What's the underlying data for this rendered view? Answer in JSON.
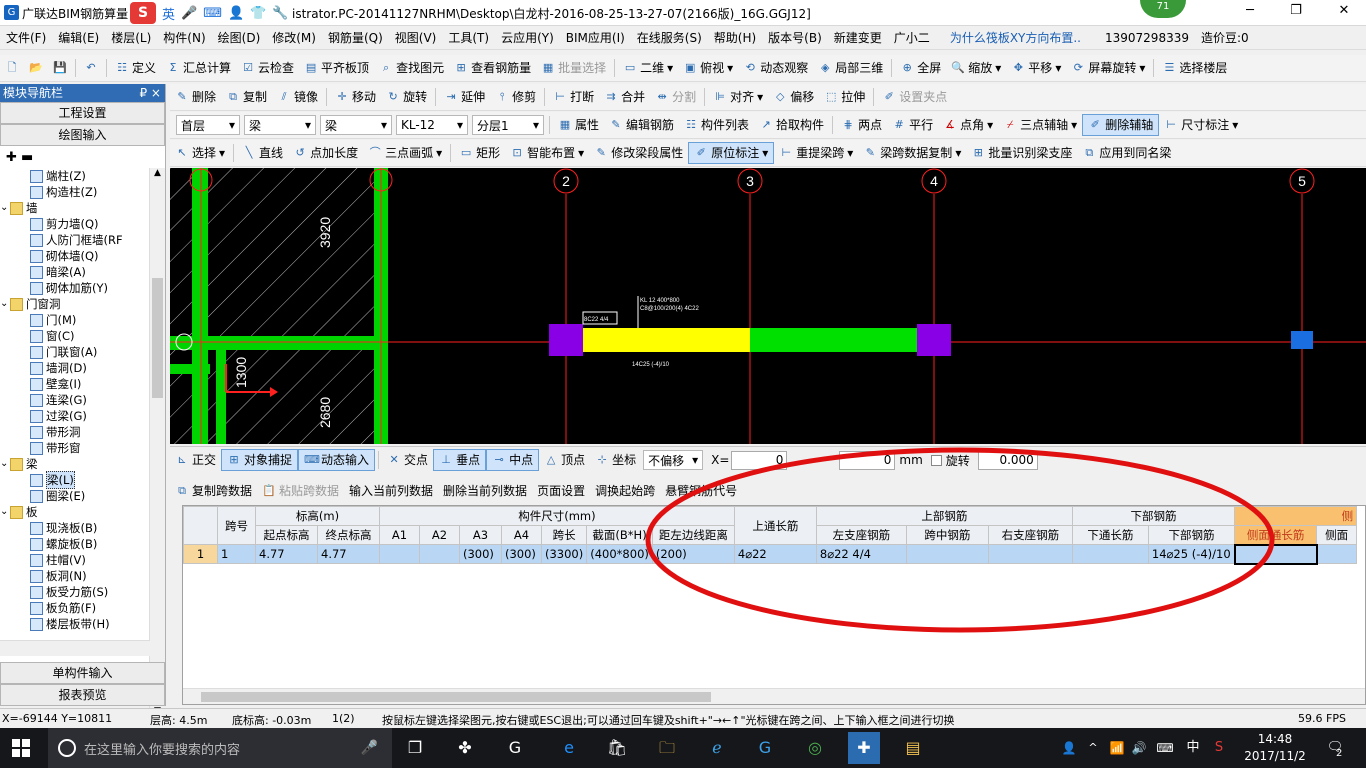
{
  "titlebar": {
    "app_title": "广联达BIM钢筋算量",
    "file_path": "istrator.PC-20141127NRHM\\Desktop\\白龙村-2016-08-25-13-27-07(2166版)_16G.GGJ12]",
    "ime_brand": "S",
    "ime_lang": "英",
    "notif_count": "71"
  },
  "menu": [
    "文件(F)",
    "编辑(E)",
    "楼层(L)",
    "构件(N)",
    "绘图(D)",
    "修改(M)",
    "钢筋量(Q)",
    "视图(V)",
    "工具(T)",
    "云应用(Y)",
    "BIM应用(I)",
    "在线服务(S)",
    "帮助(H)",
    "版本号(B)",
    "新建变更",
    "广小二",
    "为什么筏板XY方向布置..",
    "13907298339",
    "造价豆:0"
  ],
  "toolbar1": [
    "定义",
    "汇总计算",
    "云检查",
    "平齐板顶",
    "查找图元",
    "查看钢筋量",
    "批量选择",
    "二维",
    "俯视",
    "动态观察",
    "局部三维",
    "全屏",
    "缩放",
    "平移",
    "屏幕旋转",
    "选择楼层"
  ],
  "toolbar2": [
    "删除",
    "复制",
    "镜像",
    "移动",
    "旋转",
    "延伸",
    "修剪",
    "打断",
    "合并",
    "分割",
    "对齐",
    "偏移",
    "拉伸",
    "设置夹点"
  ],
  "toolbar3": {
    "floor": "首层",
    "type1": "梁",
    "type2": "梁",
    "member": "KL-12",
    "layer": "分层1",
    "items": [
      "属性",
      "编辑钢筋",
      "构件列表",
      "拾取构件",
      "两点",
      "平行",
      "点角",
      "三点辅轴",
      "删除辅轴",
      "尺寸标注"
    ]
  },
  "toolbar4": [
    "选择",
    "直线",
    "点加长度",
    "三点画弧",
    "矩形",
    "智能布置",
    "修改梁段属性",
    "原位标注",
    "重提梁跨",
    "梁跨数据复制",
    "批量识别梁支座",
    "应用到同名梁"
  ],
  "leftpanel": {
    "title": "模块导航栏",
    "pin": "₽ ×",
    "btn_project": "工程设置",
    "btn_draw": "绘图输入",
    "btn_single": "单构件输入",
    "btn_report": "报表预览",
    "tree": [
      {
        "label": "端柱(Z)",
        "indent": 3,
        "folder": false
      },
      {
        "label": "构造柱(Z)",
        "indent": 3,
        "folder": false
      },
      {
        "label": "墙",
        "indent": 1,
        "folder": true
      },
      {
        "label": "剪力墙(Q)",
        "indent": 3,
        "folder": false
      },
      {
        "label": "人防门框墙(RF",
        "indent": 3,
        "folder": false
      },
      {
        "label": "砌体墙(Q)",
        "indent": 3,
        "folder": false
      },
      {
        "label": "暗梁(A)",
        "indent": 3,
        "folder": false
      },
      {
        "label": "砌体加筋(Y)",
        "indent": 3,
        "folder": false
      },
      {
        "label": "门窗洞",
        "indent": 1,
        "folder": true
      },
      {
        "label": "门(M)",
        "indent": 3,
        "folder": false
      },
      {
        "label": "窗(C)",
        "indent": 3,
        "folder": false
      },
      {
        "label": "门联窗(A)",
        "indent": 3,
        "folder": false
      },
      {
        "label": "墙洞(D)",
        "indent": 3,
        "folder": false
      },
      {
        "label": "壁龛(I)",
        "indent": 3,
        "folder": false
      },
      {
        "label": "连梁(G)",
        "indent": 3,
        "folder": false
      },
      {
        "label": "过梁(G)",
        "indent": 3,
        "folder": false
      },
      {
        "label": "带形洞",
        "indent": 3,
        "folder": false
      },
      {
        "label": "带形窗",
        "indent": 3,
        "folder": false
      },
      {
        "label": "梁",
        "indent": 1,
        "folder": true
      },
      {
        "label": "梁(L)",
        "indent": 3,
        "folder": false,
        "selected": true
      },
      {
        "label": "圈梁(E)",
        "indent": 3,
        "folder": false
      },
      {
        "label": "板",
        "indent": 1,
        "folder": true
      },
      {
        "label": "现浇板(B)",
        "indent": 3,
        "folder": false
      },
      {
        "label": "螺旋板(B)",
        "indent": 3,
        "folder": false
      },
      {
        "label": "柱帽(V)",
        "indent": 3,
        "folder": false
      },
      {
        "label": "板洞(N)",
        "indent": 3,
        "folder": false
      },
      {
        "label": "板受力筋(S)",
        "indent": 3,
        "folder": false
      },
      {
        "label": "板负筋(F)",
        "indent": 3,
        "folder": false
      },
      {
        "label": "楼层板带(H)",
        "indent": 3,
        "folder": false
      }
    ]
  },
  "canvas": {
    "axes": [
      "2",
      "3",
      "4",
      "5"
    ],
    "dims": [
      "3920",
      "1300",
      "2680"
    ],
    "texts": {
      "beam_top": "KL 12 400*800",
      "beam_stirrup": "C8@100/200(4) 4C22",
      "beam_left": "8C22 4/4",
      "beam_bottom": "14C25 (-4)/10"
    }
  },
  "snapbar": {
    "ortho": "正交",
    "snap": "对象捕捉",
    "dynamic": "动态输入",
    "intersect": "交点",
    "perp": "垂点",
    "mid": "中点",
    "vertex": "顶点",
    "coord": "坐标",
    "offset": "不偏移",
    "xlabel": "X=",
    "xval": "0",
    "yval": "0",
    "unit": "mm",
    "rotate": "旋转",
    "rotval": "0.000"
  },
  "gridtools": [
    "复制跨数据",
    "粘贴跨数据",
    "输入当前列数据",
    "删除当前列数据",
    "页面设置",
    "调换起始跨",
    "悬臂钢筋代号"
  ],
  "grid": {
    "h_span": "跨号",
    "h_elev": "标高(m)",
    "h_size": "构件尺寸(mm)",
    "h_toplong": "上通长筋",
    "h_toprebar": "上部钢筋",
    "h_botrebar": "下部钢筋",
    "h_side": "侧",
    "sub": [
      "起点标高",
      "终点标高",
      "A1",
      "A2",
      "A3",
      "A4",
      "跨长",
      "截面(B*H)",
      "距左边线距离",
      "左支座钢筋",
      "跨中钢筋",
      "右支座钢筋",
      "下通长筋",
      "下部钢筋",
      "侧面通长筋",
      "侧面"
    ],
    "row": {
      "n": "1",
      "span": "1",
      "start": "4.77",
      "end": "4.77",
      "a1": "",
      "a2": "",
      "a3": "(300)",
      "a4": "(300)",
      "len": "(3300)",
      "sec": "(400*800)",
      "dist": "(200)",
      "toplong": "4⌀22",
      "left": "8⌀22 4/4",
      "mid": "",
      "right": "",
      "botlong": "",
      "bot": "14⌀25 (-4)/10",
      "side": "",
      "side2": ""
    }
  },
  "statusbar": {
    "coords": "X=-69144 Y=10811",
    "floorh": "层高: 4.5m",
    "base": "底标高: -0.03m",
    "count": "1(2)",
    "hint": "按鼠标左键选择梁图元,按右键或ESC退出;可以通过回车键及shift+\"→←↑\"光标键在跨之间、上下输入框之间进行切换",
    "fps": "59.6 FPS"
  },
  "taskbar": {
    "search": "在这里输入你要搜索的内容",
    "time": "14:48",
    "date": "2017/11/2",
    "lang": "中",
    "notif": "2"
  },
  "colors": {
    "accent": "#2f6cb4",
    "canvas_bg": "#000000",
    "beam_yellow": "#ffff00",
    "beam_green": "#00e000",
    "column_purple": "#8a00e6",
    "axis_red": "#ff2020",
    "annotation_red": "#e01010"
  }
}
